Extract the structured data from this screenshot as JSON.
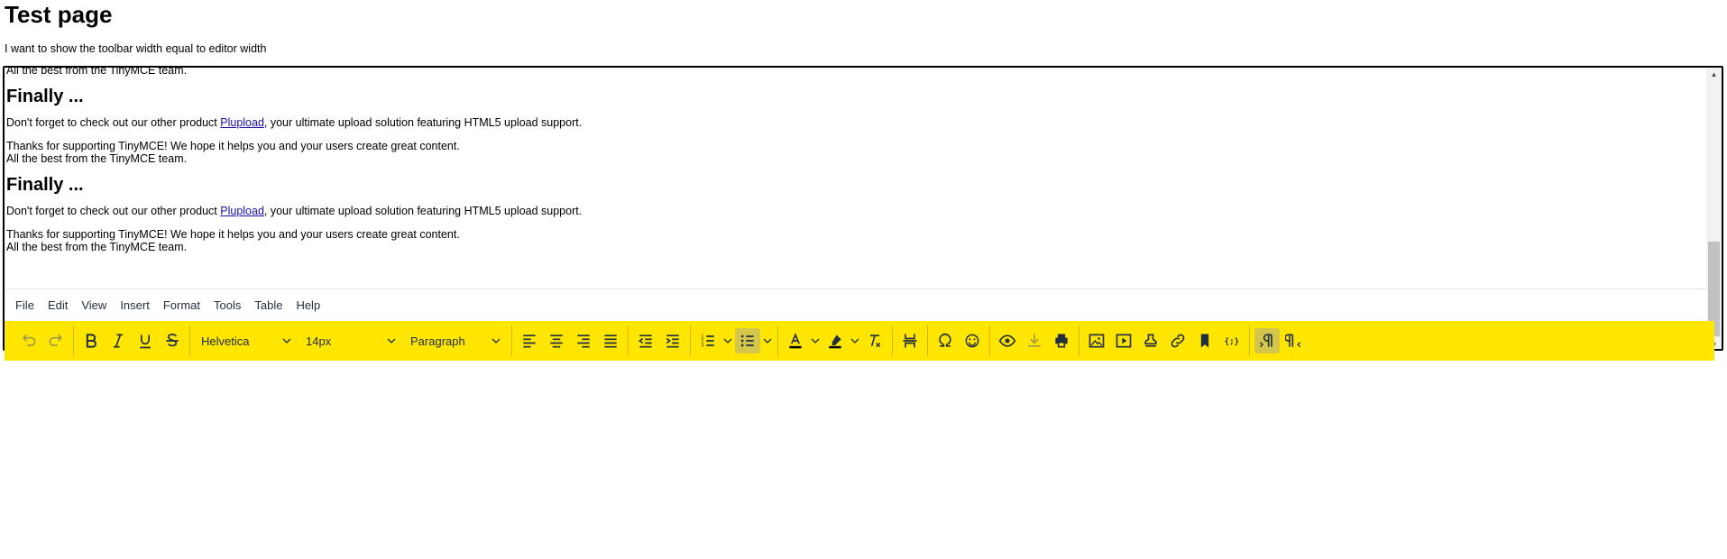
{
  "page": {
    "title": "Test page",
    "description": "I want to show the toolbar width equal to editor width"
  },
  "content": {
    "top_line": "All the best from the TinyMCE team.",
    "blocks": [
      {
        "heading": "Finally ...",
        "p1_before": "Don't forget to check out our other product ",
        "p1_link": "Plupload",
        "p1_after": ", your ultimate upload solution featuring HTML5 upload support.",
        "p2_line1": "Thanks for supporting TinyMCE! We hope it helps you and your users create great content.",
        "p2_line2": "All the best from the TinyMCE team."
      },
      {
        "heading": "Finally ...",
        "p1_before": "Don't forget to check out our other product ",
        "p1_link": "Plupload",
        "p1_after": ", your ultimate upload solution featuring HTML5 upload support.",
        "p2_line1": "Thanks for supporting TinyMCE! We hope it helps you and your users create great content.",
        "p2_line2": "All the best from the TinyMCE team."
      }
    ]
  },
  "menubar": {
    "items": [
      "File",
      "Edit",
      "View",
      "Insert",
      "Format",
      "Tools",
      "Table",
      "Help"
    ]
  },
  "toolbar": {
    "font_family": "Helvetica",
    "font_size": "14px",
    "block_format": "Paragraph",
    "icons": {
      "undo": "undo-icon",
      "redo": "redo-icon",
      "bold": "bold-icon",
      "italic": "italic-icon",
      "underline": "underline-icon",
      "strikethrough": "strikethrough-icon",
      "align_left": "align-left-icon",
      "align_center": "align-center-icon",
      "align_right": "align-right-icon",
      "align_justify": "align-justify-icon",
      "outdent": "outdent-icon",
      "indent": "indent-icon",
      "numlist": "numbered-list-icon",
      "bullist": "bulleted-list-icon",
      "forecolor": "text-color-icon",
      "backcolor": "highlight-color-icon",
      "removeformat": "remove-format-icon",
      "pagebreak": "page-break-icon",
      "charmap": "omega-icon",
      "emoticons": "emoji-icon",
      "preview": "preview-eye-icon",
      "save": "save-icon",
      "print": "print-icon",
      "image": "image-icon",
      "media": "media-icon",
      "template": "template-icon",
      "link": "link-icon",
      "anchor": "bookmark-icon",
      "code": "code-icon",
      "ltr": "ltr-icon",
      "rtl": "rtl-icon"
    }
  },
  "colors": {
    "toolbar_background": "#ffe600",
    "link": "#1a0dab",
    "active_button": "#d4c64a"
  }
}
